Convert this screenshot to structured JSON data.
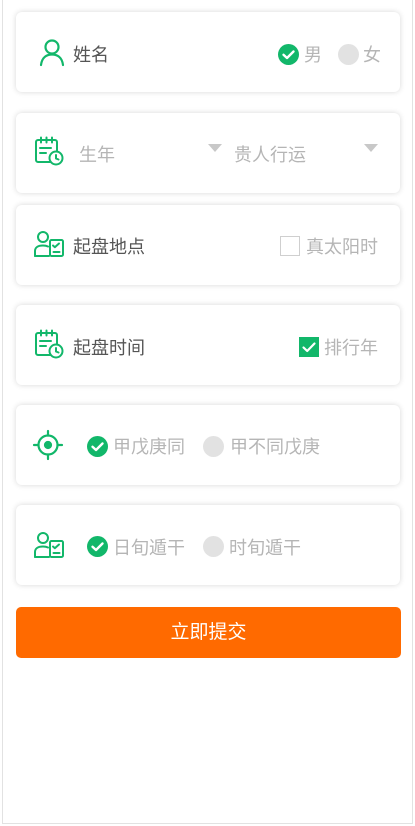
{
  "name_card": {
    "label": "姓名",
    "gender_options": [
      "男",
      "女"
    ],
    "selected_gender": "男"
  },
  "year_card": {
    "year_select": "生年",
    "star_select": "贵人行运"
  },
  "place_card": {
    "label": "起盘地点",
    "true_solar_time_label": "真太阳时",
    "true_solar_time_checked": false
  },
  "time_card": {
    "label": "起盘时间",
    "pai_xing_nian_label": "排行年",
    "pai_xing_nian_checked": true
  },
  "jia_card": {
    "options": [
      "甲戊庚同",
      "甲不同戊庚"
    ],
    "selected": "甲戊庚同"
  },
  "dun_card": {
    "options": [
      "日旬遁干",
      "时旬遁干"
    ],
    "selected": "日旬遁干"
  },
  "submit_label": "立即提交",
  "colors": {
    "accent_green": "#12b76a",
    "submit_orange": "#ff6a00",
    "muted_text": "#b5b5b5"
  },
  "icons": [
    "user-icon",
    "calendar-clock-icon",
    "person-checklist-icon",
    "target-icon"
  ]
}
